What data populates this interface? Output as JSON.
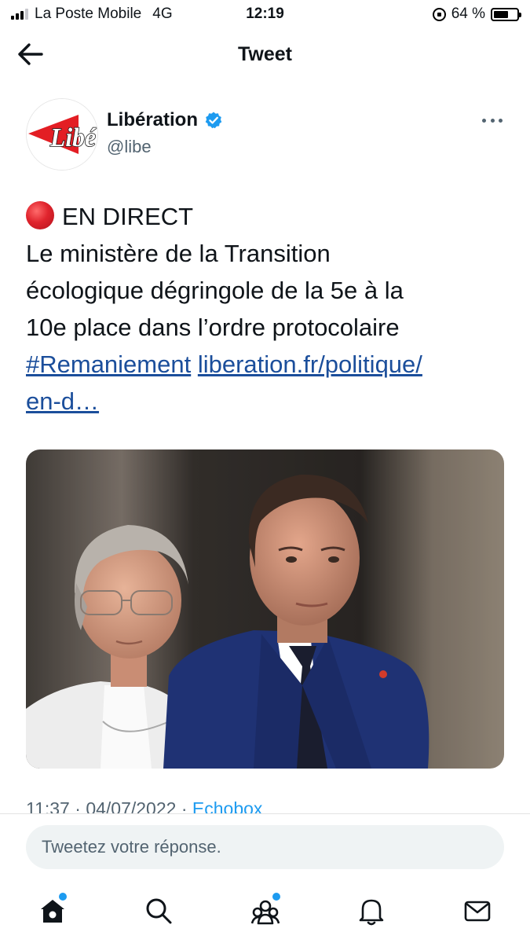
{
  "status_bar": {
    "carrier": "La Poste Mobile",
    "network": "4G",
    "time": "12:19",
    "battery_percent": "64 %",
    "battery_level": 0.64
  },
  "header": {
    "title": "Tweet"
  },
  "tweet": {
    "avatar_logo_text": "Libé",
    "author_name": "Libération",
    "verified": true,
    "handle": "@libe",
    "text_lines": [
      "EN DIRECT",
      "Le ministère de la Transition",
      "écologique dégringole de la 5e à la",
      "10e place dans l’ordre protocolaire"
    ],
    "hashtag": "#Remaniement",
    "link_part1": "liberation.fr/politique/",
    "link_part2": "en-d…",
    "meta": {
      "time": "11:37",
      "date": "04/07/2022",
      "source": "Echobox",
      "separator": "·"
    }
  },
  "reply": {
    "placeholder": "Tweetez votre réponse."
  },
  "colors": {
    "link": "#1b4e9b",
    "accent": "#1d9bf0",
    "verified": "#1d9bf0",
    "live_dot": "#e0242d"
  },
  "nav": {
    "items": [
      {
        "icon": "home-icon",
        "has_notification": true
      },
      {
        "icon": "search-icon",
        "has_notification": false
      },
      {
        "icon": "communities-icon",
        "has_notification": true
      },
      {
        "icon": "bell-icon",
        "has_notification": false
      },
      {
        "icon": "mail-icon",
        "has_notification": false
      }
    ]
  }
}
